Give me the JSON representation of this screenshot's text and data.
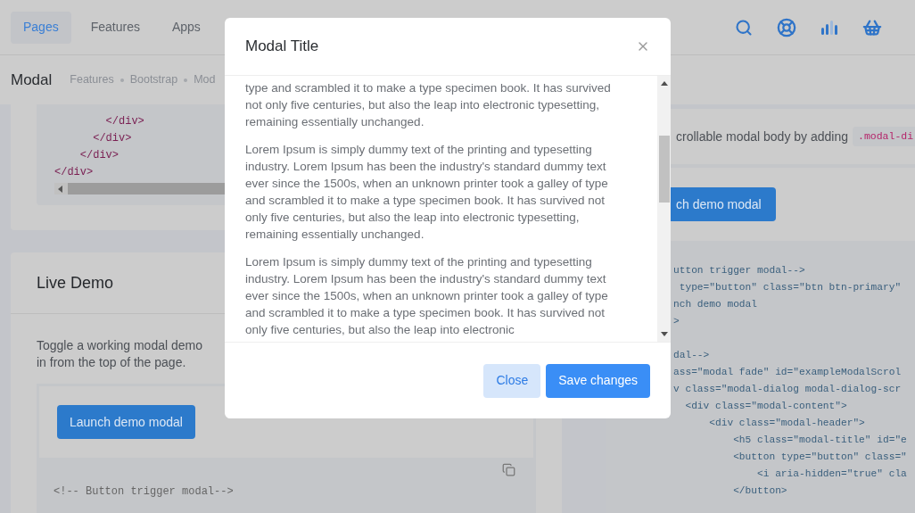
{
  "nav": {
    "tabs": [
      {
        "label": "Pages",
        "selected": true
      },
      {
        "label": "Features",
        "selected": false
      },
      {
        "label": "Apps",
        "selected": false
      }
    ]
  },
  "page_header": {
    "title": "Modal",
    "breadcrumbs": [
      "Features",
      "Bootstrap",
      "Mod"
    ]
  },
  "top_code": {
    "lines": [
      "        </div>",
      "      </div>",
      "    </div>",
      "</div>"
    ]
  },
  "live_demo": {
    "title": "Live Demo",
    "description": [
      "Toggle a working modal demo",
      "in from the top of the page."
    ],
    "button": "Launch demo modal",
    "code_lines": [
      "<!-- Button trigger modal-->"
    ]
  },
  "right_card": {
    "description": "crollable modal body by adding",
    "code_chip": ".modal-di",
    "button": "ch demo modal",
    "code_groups": [
      [
        "utton trigger modal-->",
        " type=\"button\" class=\"btn btn-primary\"",
        "nch demo modal",
        ">"
      ],
      [
        "dal-->",
        "ass=\"modal fade\" id=\"exampleModalScrol",
        "v class=\"modal-dialog modal-dialog-scr",
        "  <div class=\"modal-content\">",
        "      <div class=\"modal-header\">",
        "          <h5 class=\"modal-title\" id=\"e",
        "          <button type=\"button\" class=\"",
        "              <i aria-hidden=\"true\" cla",
        "          </button>"
      ]
    ]
  },
  "modal": {
    "title": "Modal Title",
    "paragraphs": [
      "type and scrambled it to make a type specimen book. It has survived not only five centuries, but also the leap into electronic typesetting, remaining essentially unchanged.",
      "Lorem Ipsum is simply dummy text of the printing and typesetting industry. Lorem Ipsum has been the industry's standard dummy text ever since the 1500s, when an unknown printer took a galley of type and scrambled it to make a type specimen book. It has survived not only five centuries, but also the leap into electronic typesetting, remaining essentially unchanged.",
      "Lorem Ipsum is simply dummy text of the printing and typesetting industry. Lorem Ipsum has been the industry's standard dummy text ever since the 1500s, when an unknown printer took a galley of type and scrambled it to make a type specimen book. It has survived not only five centuries, but also the leap into electronic"
    ],
    "buttons": [
      {
        "label": "Close",
        "kind": "secondary"
      },
      {
        "label": "Save changes",
        "kind": "primary"
      }
    ]
  }
}
